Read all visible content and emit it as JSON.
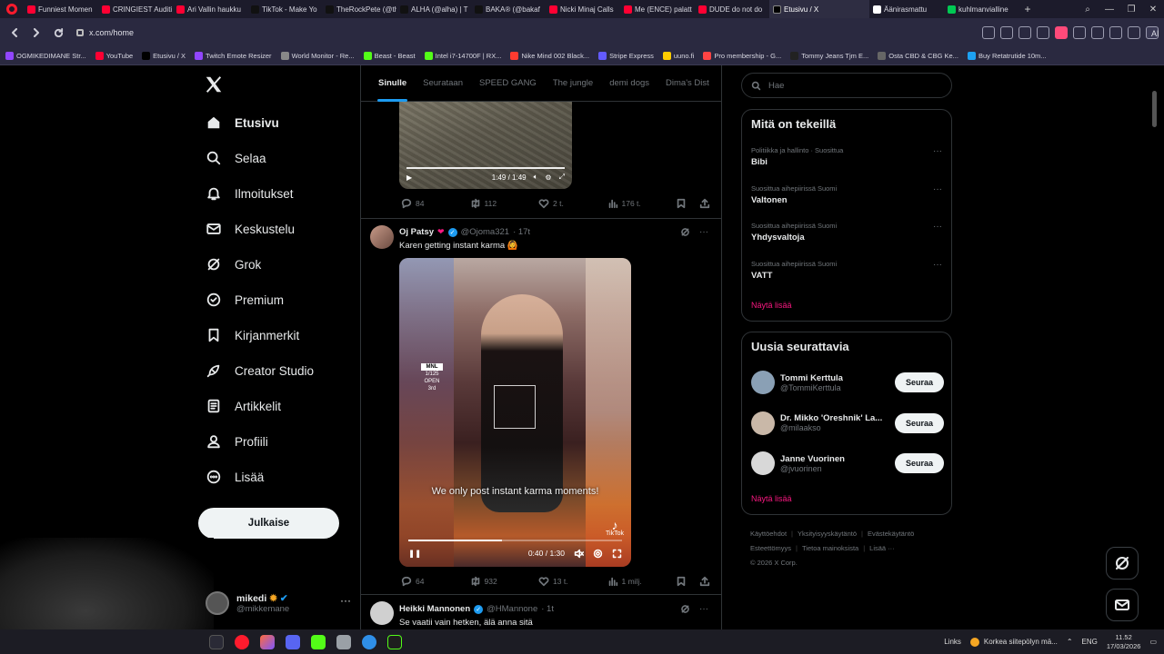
{
  "browser": {
    "tabs": [
      {
        "label": "Funniest Momen",
        "color": "#ff0033"
      },
      {
        "label": "CRINGIEST Auditi",
        "color": "#ff0033"
      },
      {
        "label": "Ari Vallin haukku",
        "color": "#ff0033"
      },
      {
        "label": "TikTok - Make Yo",
        "color": "#111111"
      },
      {
        "label": "TheRockPete (@th",
        "color": "#111111"
      },
      {
        "label": "ALHA (@alha) | T",
        "color": "#111111"
      },
      {
        "label": "BAKA® (@bakaf",
        "color": "#111111"
      },
      {
        "label": "Nicki Minaj Calls",
        "color": "#ff0033"
      },
      {
        "label": "Me (ENCE) palatt",
        "color": "#ff0033"
      },
      {
        "label": "DUDE do not do",
        "color": "#ff0033"
      },
      {
        "label": "Etusivu / X",
        "color": "#000000",
        "active": true
      },
      {
        "label": "Äänirasmattu",
        "color": "#ffffff"
      },
      {
        "label": "kuhlmanvialline",
        "color": "#00c853"
      }
    ],
    "url": "x.com/home",
    "ai_label": "AI",
    "bookmarks": [
      {
        "label": "OGMIKEDIMANE Str...",
        "color": "#9146ff"
      },
      {
        "label": "YouTube",
        "color": "#ff0033"
      },
      {
        "label": "Etusivu / X",
        "color": "#000000"
      },
      {
        "label": "Twitch Emote Resizer",
        "color": "#9146ff"
      },
      {
        "label": "World Monitor - Re...",
        "color": "#888888"
      },
      {
        "label": "Beast - Beast",
        "color": "#53fc18"
      },
      {
        "label": "Intel i7-14700F | RX...",
        "color": "#53fc18"
      },
      {
        "label": "Nike Mind 002 Black...",
        "color": "#ff3b30"
      },
      {
        "label": "Stripe Express",
        "color": "#635bff"
      },
      {
        "label": "uuno.fi",
        "color": "#ffcc00"
      },
      {
        "label": "Pro membership - G...",
        "color": "#ff4444"
      },
      {
        "label": "Tommy Jeans Tjm E...",
        "color": "#222222"
      },
      {
        "label": "Osta CBD & CBG Ke...",
        "color": "#666666"
      },
      {
        "label": "Buy Retatrutide 10m...",
        "color": "#1da1f2"
      }
    ]
  },
  "nav": {
    "items": [
      {
        "label": "Etusivu",
        "icon": "home-icon",
        "bold": true
      },
      {
        "label": "Selaa",
        "icon": "search-icon"
      },
      {
        "label": "Ilmoitukset",
        "icon": "bell-icon"
      },
      {
        "label": "Keskustelu",
        "icon": "mail-icon"
      },
      {
        "label": "Grok",
        "icon": "grok-icon"
      },
      {
        "label": "Premium",
        "icon": "premium-icon"
      },
      {
        "label": "Kirjanmerkit",
        "icon": "bookmark-icon"
      },
      {
        "label": "Creator Studio",
        "icon": "rocket-icon"
      },
      {
        "label": "Artikkelit",
        "icon": "article-icon"
      },
      {
        "label": "Profiili",
        "icon": "person-icon"
      },
      {
        "label": "Lisää",
        "icon": "more-circle-icon"
      }
    ],
    "post_button": "Julkaise",
    "profile": {
      "name": "mikedi",
      "handle": "@mikkemane"
    }
  },
  "timeline": {
    "tabs": [
      "Sinulle",
      "Seurataan",
      "SPEED GANG",
      "The jungle",
      "demi dogs",
      "Dima's Dist"
    ],
    "tweet0": {
      "video_time": "1:49 / 1:49",
      "replies": "84",
      "reposts": "112",
      "likes": "2 t.",
      "views": "176 t."
    },
    "tweet1": {
      "name": "Oj Patsy",
      "handle": "@Ojoma321",
      "time": "· 17t",
      "text": "Karen getting instant karma 🙆",
      "video_caption": "We only post instant karma moments!",
      "video_sign": [
        "MNL",
        "1/125",
        "OPEN",
        "3rd"
      ],
      "watermark": "TikTok",
      "video_time": "0:40 / 1:30",
      "progress": 0.44,
      "replies": "64",
      "reposts": "932",
      "likes": "13 t.",
      "views": "1 milj."
    },
    "tweet2": {
      "name": "Heikki Mannonen",
      "handle": "@HMannone",
      "time": "· 1t",
      "text": "Se vaatii vain hetken, älä anna sitä"
    }
  },
  "sidebar": {
    "search_placeholder": "Hae",
    "trends_title": "Mitä on tekeillä",
    "trends": [
      {
        "context": "Politiikka ja hallinto · Suosittua",
        "title": "Bibi"
      },
      {
        "context": "Suosittua aihepiirissä Suomi",
        "title": "Valtonen"
      },
      {
        "context": "Suosittua aihepiirissä Suomi",
        "title": "Yhdysvaltoja"
      },
      {
        "context": "Suosittua aihepiirissä Suomi",
        "title": "VATT"
      }
    ],
    "show_more": "Näytä lisää",
    "follow_title": "Uusia seurattavia",
    "follows": [
      {
        "name": "Tommi Kerttula",
        "handle": "@TommiKerttula",
        "button": "Seuraa",
        "color": "#8aa0b5"
      },
      {
        "name": "Dr. Mikko 'Oreshnik' La...",
        "handle": "@milaakso",
        "button": "Seuraa",
        "color": "#c9b8a8"
      },
      {
        "name": "Janne Vuorinen",
        "handle": "@jvuorinen",
        "button": "Seuraa",
        "color": "#d8d8d8"
      }
    ],
    "footer": [
      "Käyttöehdot",
      "Yksityisyyskäytäntö",
      "Evästekäytäntö",
      "Esteettömyys",
      "Tietoa mainoksista",
      "Lisää ···",
      "© 2026 X Corp."
    ]
  },
  "taskbar": {
    "links": "Links",
    "weather": "Korkea siitepölyn mä...",
    "lang": "ENG",
    "time": "11.52",
    "date": "17/03/2026"
  },
  "colors": {
    "accent_blue": "#1d9bf0",
    "accent_pink": "#f91880",
    "background": "#000000"
  }
}
